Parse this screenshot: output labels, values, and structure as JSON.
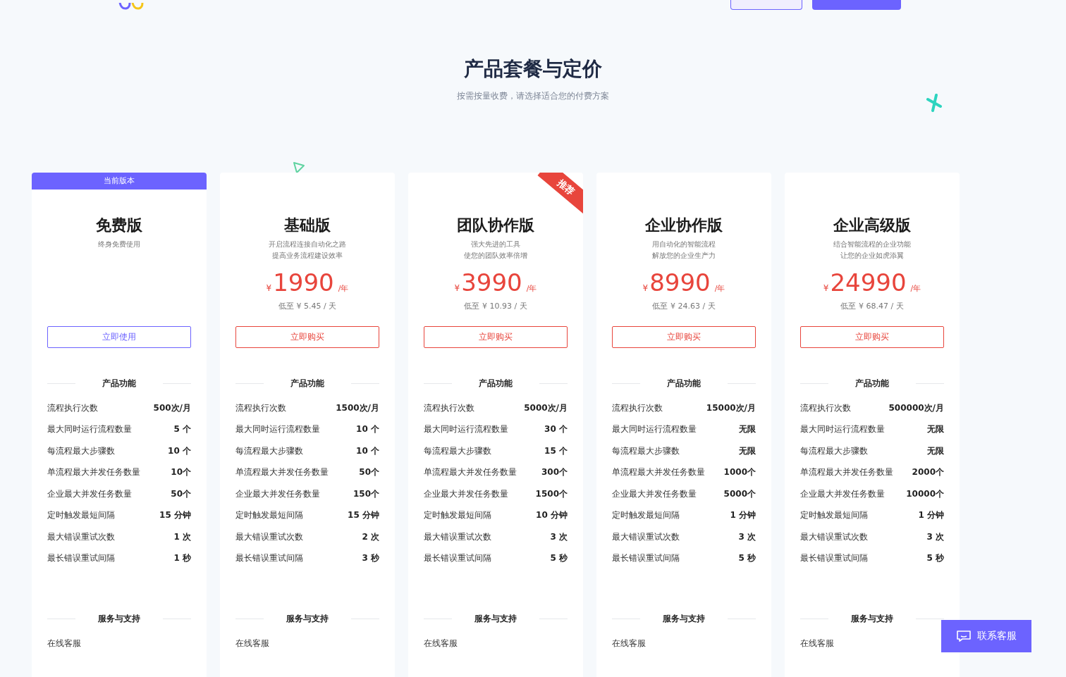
{
  "heading": {
    "title": "产品套餐与定价",
    "subtitle": "按需按量收费，请选择适合您的付费方案"
  },
  "plans": [
    {
      "name": "免费版",
      "current": true,
      "banner": "当前版本",
      "description": [
        "终身免费使用"
      ],
      "button": "立即使用",
      "features_title": "产品功能",
      "features": [
        {
          "label": "流程执行次数",
          "value": "500次/月"
        },
        {
          "label": "最大同时运行流程数量",
          "value": "5 个"
        },
        {
          "label": "每流程最大步骤数",
          "value": "10 个"
        },
        {
          "label": "单流程最大并发任务数量",
          "value": "10个"
        },
        {
          "label": "企业最大并发任务数量",
          "value": "50个"
        },
        {
          "label": "定时触发最短间隔",
          "value": "15 分钟"
        },
        {
          "label": "最大错误重试次数",
          "value": "1 次"
        },
        {
          "label": "最长错误重试间隔",
          "value": "1 秒"
        }
      ],
      "service_title": "服务与支持",
      "services": [
        "在线客服"
      ]
    },
    {
      "name": "基础版",
      "current": false,
      "description": [
        "开启流程连接自动化之路",
        "提高业务流程建设效率"
      ],
      "price": {
        "currency": "¥",
        "amount": "1990",
        "unit": "/年"
      },
      "daily": "低至 ¥ 5.45 / 天",
      "button": "立即购买",
      "features_title": "产品功能",
      "features": [
        {
          "label": "流程执行次数",
          "value": "1500次/月"
        },
        {
          "label": "最大同时运行流程数量",
          "value": "10 个"
        },
        {
          "label": "每流程最大步骤数",
          "value": "10 个"
        },
        {
          "label": "单流程最大并发任务数量",
          "value": "50个"
        },
        {
          "label": "企业最大并发任务数量",
          "value": "150个"
        },
        {
          "label": "定时触发最短间隔",
          "value": "15 分钟"
        },
        {
          "label": "最大错误重试次数",
          "value": "2 次"
        },
        {
          "label": "最长错误重试间隔",
          "value": "3 秒"
        }
      ],
      "service_title": "服务与支持",
      "services": [
        "在线客服"
      ]
    },
    {
      "name": "团队协作版",
      "current": false,
      "ribbon": "推荐",
      "description": [
        "强大先进的工具",
        "使您的团队效率倍增"
      ],
      "price": {
        "currency": "¥",
        "amount": "3990",
        "unit": "/年"
      },
      "daily": "低至 ¥ 10.93 / 天",
      "button": "立即购买",
      "features_title": "产品功能",
      "features": [
        {
          "label": "流程执行次数",
          "value": "5000次/月"
        },
        {
          "label": "最大同时运行流程数量",
          "value": "30 个"
        },
        {
          "label": "每流程最大步骤数",
          "value": "15 个"
        },
        {
          "label": "单流程最大并发任务数量",
          "value": "300个"
        },
        {
          "label": "企业最大并发任务数量",
          "value": "1500个"
        },
        {
          "label": "定时触发最短间隔",
          "value": "10 分钟"
        },
        {
          "label": "最大错误重试次数",
          "value": "3 次"
        },
        {
          "label": "最长错误重试间隔",
          "value": "5 秒"
        }
      ],
      "service_title": "服务与支持",
      "services": [
        "在线客服"
      ]
    },
    {
      "name": "企业协作版",
      "current": false,
      "description": [
        "用自动化的智能流程",
        "解放您的企业生产力"
      ],
      "price": {
        "currency": "¥",
        "amount": "8990",
        "unit": "/年"
      },
      "daily": "低至 ¥ 24.63 / 天",
      "button": "立即购买",
      "features_title": "产品功能",
      "features": [
        {
          "label": "流程执行次数",
          "value": "15000次/月"
        },
        {
          "label": "最大同时运行流程数量",
          "value": "无限"
        },
        {
          "label": "每流程最大步骤数",
          "value": "无限"
        },
        {
          "label": "单流程最大并发任务数量",
          "value": "1000个"
        },
        {
          "label": "企业最大并发任务数量",
          "value": "5000个"
        },
        {
          "label": "定时触发最短间隔",
          "value": "1 分钟"
        },
        {
          "label": "最大错误重试次数",
          "value": "3 次"
        },
        {
          "label": "最长错误重试间隔",
          "value": "5 秒"
        }
      ],
      "service_title": "服务与支持",
      "services": [
        "在线客服"
      ]
    },
    {
      "name": "企业高级版",
      "current": false,
      "description": [
        "结合智能流程的企业功能",
        "让您的企业如虎添翼"
      ],
      "price": {
        "currency": "¥",
        "amount": "24990",
        "unit": "/年"
      },
      "daily": "低至 ¥ 68.47 / 天",
      "button": "立即购买",
      "features_title": "产品功能",
      "features": [
        {
          "label": "流程执行次数",
          "value": "500000次/月"
        },
        {
          "label": "最大同时运行流程数量",
          "value": "无限"
        },
        {
          "label": "每流程最大步骤数",
          "value": "无限"
        },
        {
          "label": "单流程最大并发任务数量",
          "value": "2000个"
        },
        {
          "label": "企业最大并发任务数量",
          "value": "10000个"
        },
        {
          "label": "定时触发最短间隔",
          "value": "1 分钟"
        },
        {
          "label": "最大错误重试次数",
          "value": "3 次"
        },
        {
          "label": "最长错误重试间隔",
          "value": "5 秒"
        }
      ],
      "service_title": "服务与支持",
      "services": [
        "在线客服"
      ]
    }
  ],
  "contact_button": "联系客服"
}
